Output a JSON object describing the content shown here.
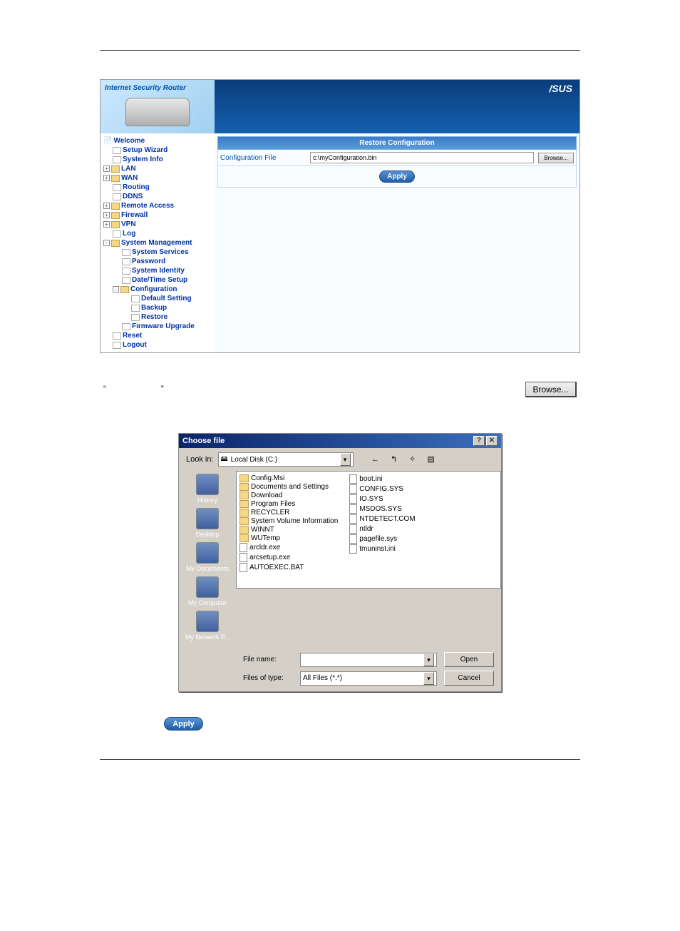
{
  "router": {
    "brand_title": "Internet Security Router",
    "brand_logo": "/SUS",
    "header": "Restore Configuration",
    "field_label": "Configuration File",
    "field_value": "c:\\myConfiguration.bin",
    "browse": "Browse...",
    "apply": "Apply",
    "nav": {
      "welcome": "Welcome",
      "setup_wizard": "Setup Wizard",
      "system_info": "System Info",
      "lan": "LAN",
      "wan": "WAN",
      "routing": "Routing",
      "ddns": "DDNS",
      "remote": "Remote Access",
      "firewall": "Firewall",
      "vpn": "VPN",
      "log": "Log",
      "sysmgmt": "System Management",
      "sys_services": "System Services",
      "password": "Password",
      "sys_identity": "System Identity",
      "datetime": "Date/Time Setup",
      "config": "Configuration",
      "default": "Default Setting",
      "backup": "Backup",
      "restore": "Restore",
      "fw": "Firmware Upgrade",
      "reset": "Reset",
      "logout": "Logout"
    }
  },
  "body_text": {
    "quote1": "“",
    "quote2": "”",
    "browse": "Browse..."
  },
  "dialog": {
    "title": "Choose file",
    "lookin": "Look in:",
    "drive": "Local Disk (C:)",
    "sidebar": [
      "History",
      "Desktop",
      "My Documents",
      "My Computer",
      "My Network P..."
    ],
    "tools": {
      "back": "←",
      "up": "↰",
      "new": "✧",
      "view": "▤"
    },
    "col1": [
      {
        "t": "folder",
        "n": "Config.Msi"
      },
      {
        "t": "folder",
        "n": "Documents and Settings"
      },
      {
        "t": "folder",
        "n": "Download"
      },
      {
        "t": "folder",
        "n": "Program Files"
      },
      {
        "t": "folder",
        "n": "RECYCLER"
      },
      {
        "t": "folder",
        "n": "System Volume Information"
      },
      {
        "t": "folder",
        "n": "WINNT"
      },
      {
        "t": "folder",
        "n": "WUTemp"
      },
      {
        "t": "file",
        "n": "arcldr.exe"
      },
      {
        "t": "file",
        "n": "arcsetup.exe"
      },
      {
        "t": "file",
        "n": "AUTOEXEC.BAT"
      }
    ],
    "col2": [
      {
        "t": "file",
        "n": "boot.ini"
      },
      {
        "t": "file",
        "n": "CONFIG.SYS"
      },
      {
        "t": "file",
        "n": "IO.SYS"
      },
      {
        "t": "file",
        "n": "MSDOS.SYS"
      },
      {
        "t": "file",
        "n": "NTDETECT.COM"
      },
      {
        "t": "file",
        "n": "ntldr"
      },
      {
        "t": "file",
        "n": "pagefile.sys"
      },
      {
        "t": "file",
        "n": "tmuninst.ini"
      }
    ],
    "fname_lbl": "File name:",
    "ftype_lbl": "Files of type:",
    "ftype_val": "All Files (*.*)",
    "open": "Open",
    "cancel": "Cancel"
  },
  "apply_bottom": "Apply"
}
